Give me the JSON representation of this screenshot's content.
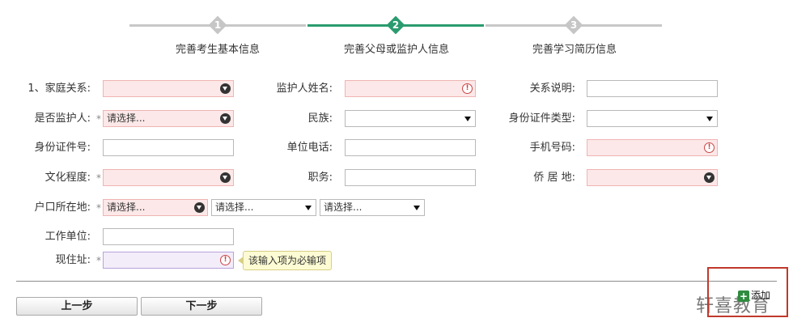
{
  "stepper": {
    "steps": [
      {
        "num": "1",
        "label": "完善考生基本信息",
        "active": false
      },
      {
        "num": "2",
        "label": "完善父母或监护人信息",
        "active": true
      },
      {
        "num": "3",
        "label": "完善学习简历信息",
        "active": false
      }
    ]
  },
  "form": {
    "relation": {
      "label": "1、家庭关系:",
      "value": ""
    },
    "guardian_name": {
      "label": "监护人姓名:",
      "value": ""
    },
    "relation_desc": {
      "label": "关系说明:",
      "value": ""
    },
    "is_guardian": {
      "label": "是否监护人:",
      "value": "请选择..."
    },
    "ethnicity": {
      "label": "民族:",
      "value": ""
    },
    "id_type": {
      "label": "身份证件类型:",
      "value": ""
    },
    "id_number": {
      "label": "身份证件号:",
      "value": ""
    },
    "work_phone": {
      "label": "单位电话:",
      "value": ""
    },
    "mobile": {
      "label": "手机号码:",
      "value": ""
    },
    "education": {
      "label": "文化程度:",
      "value": ""
    },
    "position": {
      "label": "职务:",
      "value": ""
    },
    "overseas": {
      "label": "侨 居 地:",
      "value": ""
    },
    "hukou": {
      "label": "户口所在地:",
      "select1": "请选择...",
      "select2": "请选择...",
      "select3": "请选择..."
    },
    "workplace": {
      "label": "工作单位:",
      "value": ""
    },
    "address": {
      "label": "现住址:",
      "value": ""
    },
    "required_mark": "*",
    "error_mark": "!"
  },
  "tooltip": {
    "text": "该输入项为必输项"
  },
  "buttons": {
    "prev": "上一步",
    "next": "下一步",
    "add": "添加"
  },
  "watermark": "轩喜教育",
  "colors": {
    "active_step": "#2a9b6e",
    "error_bg": "#fce8e8",
    "highlight_border": "#c0392b"
  }
}
